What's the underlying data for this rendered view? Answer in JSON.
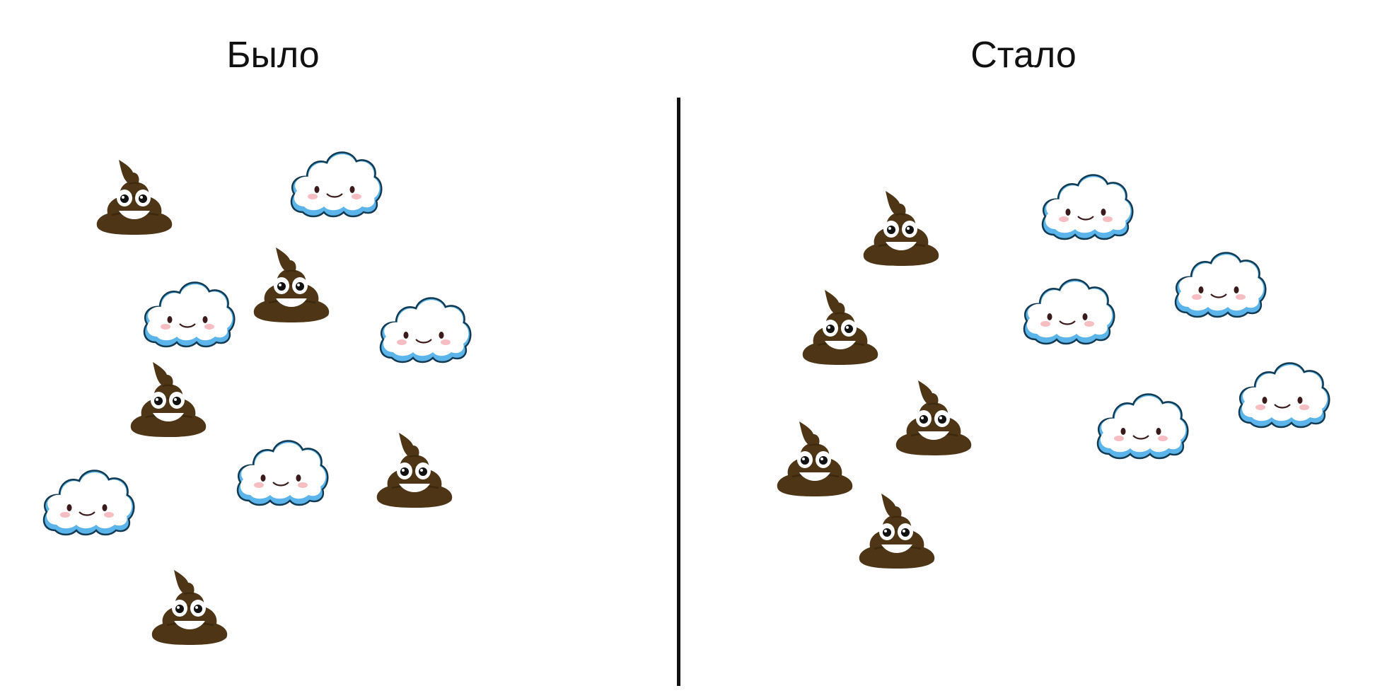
{
  "panels": {
    "left": {
      "title": "Было"
    },
    "right": {
      "title": "Стало"
    }
  },
  "icons": {
    "poop": "pile-of-poo-icon",
    "cloud": "smiling-cloud-icon"
  },
  "colors": {
    "poop": "#4d3516",
    "cloud_edge": "#5bb4ea",
    "blush": "#f5b3b8",
    "divider": "#111111",
    "text": "#111111"
  }
}
